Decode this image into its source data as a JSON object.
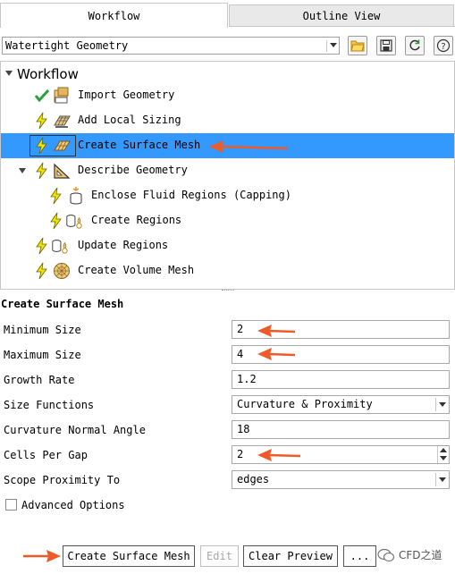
{
  "tabs": [
    {
      "label": "Workflow",
      "active": true
    },
    {
      "label": "Outline View",
      "active": false
    }
  ],
  "workflow_select": {
    "value": "Watertight Geometry"
  },
  "toolbar_icons": [
    "open-folder-icon",
    "save-icon",
    "refresh-icon",
    "help-icon"
  ],
  "help_glyph": "?",
  "tree": {
    "title": "Workflow",
    "items": [
      {
        "label": "Import Geometry",
        "status": "done"
      },
      {
        "label": "Add Local Sizing",
        "status": "pending"
      },
      {
        "label": "Create Surface Mesh",
        "status": "pending",
        "selected": true
      },
      {
        "label": "Describe Geometry",
        "status": "pending",
        "expanded": true
      },
      {
        "label": "Enclose Fluid Regions (Capping)",
        "status": "pending"
      },
      {
        "label": "Create Regions",
        "status": "pending"
      },
      {
        "label": "Update Regions",
        "status": "pending"
      },
      {
        "label": "Create Volume Mesh",
        "status": "pending"
      }
    ]
  },
  "task": {
    "title": "Create Surface Mesh",
    "fields": [
      {
        "label": "Minimum Size",
        "value": "2"
      },
      {
        "label": "Maximum Size",
        "value": "4"
      },
      {
        "label": "Growth Rate",
        "value": "1.2"
      },
      {
        "label": "Size Functions",
        "value": "Curvature & Proximity"
      },
      {
        "label": "Curvature Normal Angle",
        "value": "18"
      },
      {
        "label": "Cells Per Gap",
        "value": "2"
      },
      {
        "label": "Scope Proximity To",
        "value": "edges"
      }
    ],
    "advanced_label": "Advanced Options",
    "advanced_checked": false
  },
  "buttons": {
    "create": "Create Surface Mesh",
    "edit": "Edit",
    "clear": "Clear Preview",
    "more": "..."
  },
  "watermark": "CFD之道",
  "colors": {
    "selection": "#3399ff",
    "annotation_arrow": "#f05a28",
    "done_check": "#2e9e3e",
    "lightning": "#f2e600"
  }
}
